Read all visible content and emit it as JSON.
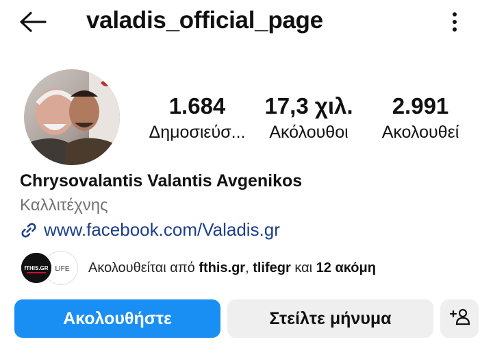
{
  "header": {
    "username": "valadis_official_page",
    "back_icon": "back-arrow-icon",
    "more_icon": "more-vertical-icon"
  },
  "profile": {
    "stats": [
      {
        "value": "1.684",
        "label": "Δημοσιεύσ..."
      },
      {
        "value": "17,3 χιλ.",
        "label": "Ακόλουθοι"
      },
      {
        "value": "2.991",
        "label": "Ακολουθεί"
      }
    ],
    "name": "Chrysovalantis Valantis Avgenikos",
    "category": "Καλλιτέχνης",
    "link": "www.facebook.com/Valadis.gr"
  },
  "mutual": {
    "prefix": "Ακολουθείται από ",
    "account1": "fthis.gr",
    "sep": ", ",
    "account2": "tlifegr",
    "and": " και ",
    "others": "12 ακόμη",
    "avatar1_text": "fTHIS.GR",
    "avatar2_text": "LIFE"
  },
  "actions": {
    "follow": "Ακολουθήστε",
    "message": "Στείλτε μήνυμα",
    "add_icon": "add-person-icon"
  },
  "colors": {
    "accent": "#1a8ff3",
    "link": "#1b3f8b",
    "secondary_button": "#efefef",
    "muted_text": "#737373"
  }
}
